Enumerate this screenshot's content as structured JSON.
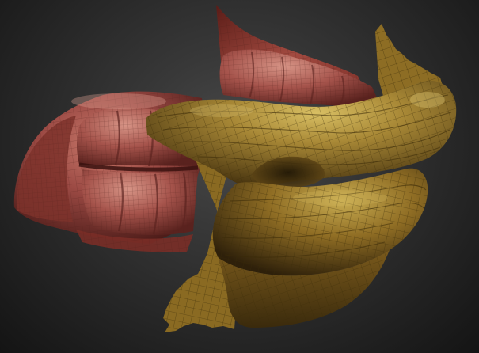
{
  "viewport": {
    "background_center": "#4a4a4a",
    "background_edge": "#141414"
  },
  "models": {
    "teeth_mesh": {
      "surface_color": "#9c4a44",
      "highlight_color": "#c97a6c",
      "wire_color": "#5a2420"
    },
    "lips_mesh": {
      "surface_color": "#8a6d26",
      "highlight_color": "#c9ad52",
      "wire_color": "#3e2e0c"
    }
  }
}
